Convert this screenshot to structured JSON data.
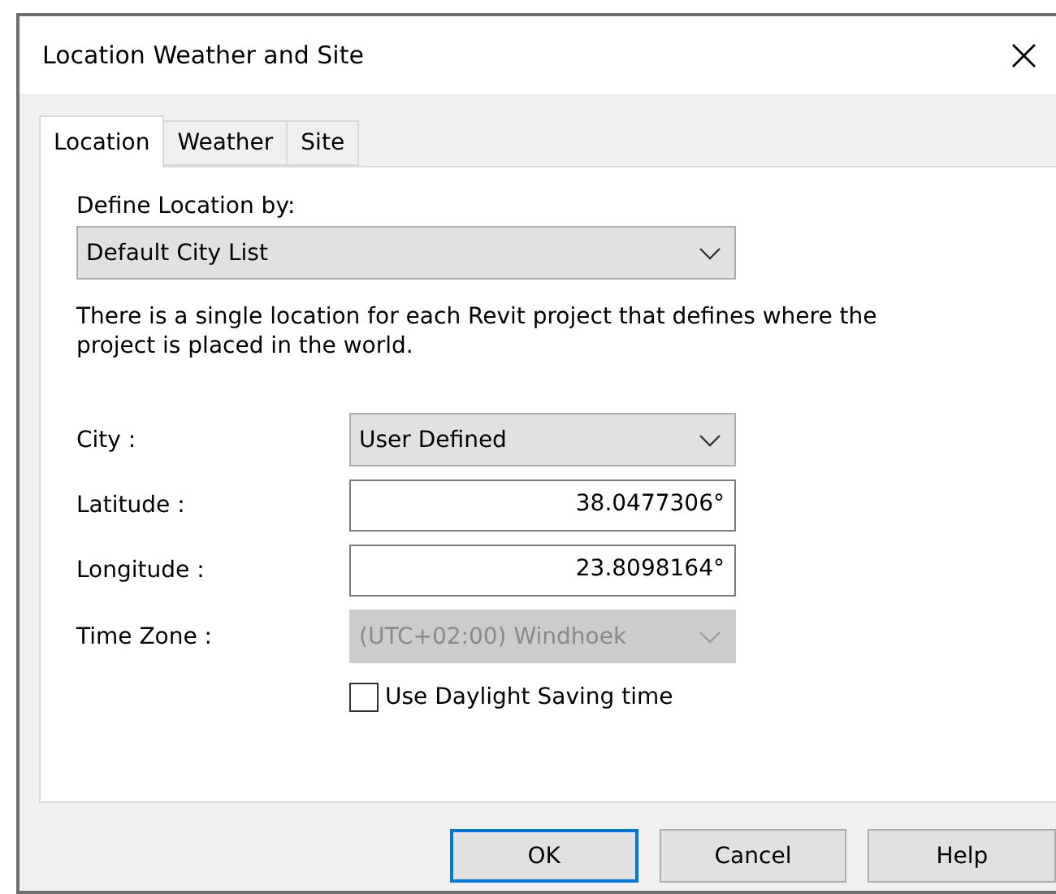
{
  "window": {
    "title": "Location Weather and Site",
    "close": "×"
  },
  "tabs": [
    {
      "label": "Location",
      "selected": true
    },
    {
      "label": "Weather",
      "selected": false
    },
    {
      "label": "Site",
      "selected": false
    }
  ],
  "define_location": {
    "label": "Define Location by:",
    "value": "Default City List"
  },
  "description": "There is a single location for each Revit project that defines where the project is placed in the world.",
  "fields": [
    {
      "kind": "dropdown",
      "label": "City :",
      "value": "User Defined",
      "disabled": false
    },
    {
      "kind": "text",
      "label": "Latitude :",
      "value": "38.0477306°",
      "disabled": false
    },
    {
      "kind": "text",
      "label": "Longitude :",
      "value": "23.8098164°",
      "disabled": false
    },
    {
      "kind": "dropdown",
      "label": "Time Zone :",
      "value": "(UTC+02:00) Windhoek",
      "disabled": true
    }
  ],
  "daylight_saving": {
    "label": "Use Daylight Saving time",
    "checked": false
  },
  "buttons": [
    {
      "label": "OK",
      "default": true
    },
    {
      "label": "Cancel",
      "default": false
    },
    {
      "label": "Help",
      "default": false
    }
  ]
}
